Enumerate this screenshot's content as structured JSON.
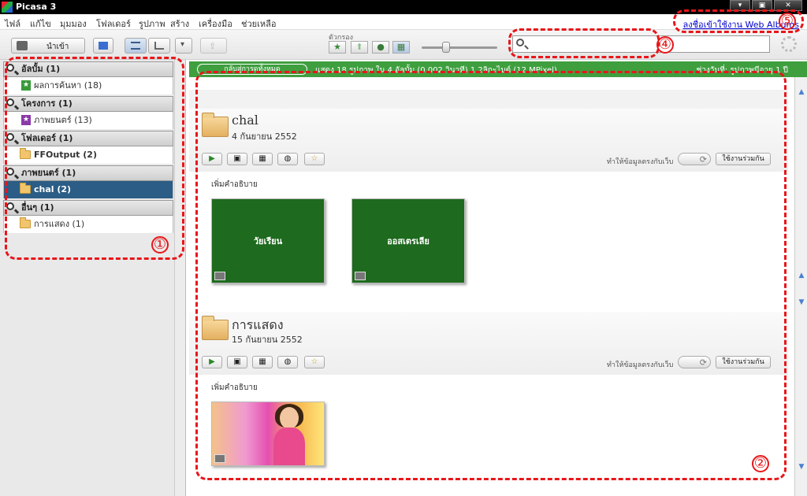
{
  "window": {
    "title": "Picasa 3"
  },
  "menu": [
    "ไฟล์",
    "แก้ไข",
    "มุมมอง",
    "โฟลเดอร์",
    "รูปภาพ",
    "สร้าง",
    "เครื่องมือ",
    "ช่วยเหลือ"
  ],
  "signin_link": "ลงชื่อเข้าใช้งาน Web Albums",
  "toolbar": {
    "import_label": "นำเข้า",
    "filter_label": "ตัวกรอง",
    "search_placeholder": ""
  },
  "sidebar": {
    "groups": [
      {
        "label": "อัลบั้ม (1)",
        "items": [
          {
            "label": "ผลการค้นหา (18)",
            "icon": "star-icon",
            "selected": false
          }
        ]
      },
      {
        "label": "โครงการ (1)",
        "items": [
          {
            "label": "ภาพยนตร์ (13)",
            "icon": "movie-icon",
            "selected": false
          }
        ]
      },
      {
        "label": "โฟลเดอร์ (1)",
        "items": [
          {
            "label": "FFOutput (2)",
            "icon": "folder-icon",
            "selected": false
          }
        ]
      },
      {
        "label": "ภาพยนตร์ (1)",
        "items": [
          {
            "label": "chal (2)",
            "icon": "folder-icon",
            "selected": true
          }
        ]
      },
      {
        "label": "อื่นๆ (1)",
        "items": [
          {
            "label": "การแสดง (1)",
            "icon": "folder-icon",
            "selected": false
          }
        ]
      }
    ]
  },
  "greenbar": {
    "back_label": "กลับสู่การดูทั้งหมด",
    "info": "แสดง 18 รูปภาพ ใน 4 อัลบั้ม (0.002 วินาที) 1.2ลิกะไบต์ (12 MPixel)",
    "range": "ช่วงวันที่: รูปภาพมีอายุ 1 ปี"
  },
  "albums": [
    {
      "title": "chal",
      "date": "4 กันยายน 2552",
      "sync_label": "ทำให้ข้อมูลตรงกับเว็บ",
      "share_label": "ใช้งานร่วมกัน",
      "add_caption": "เพิ่มคำอธิบาย",
      "items": [
        {
          "caption": "วัยเรียน"
        },
        {
          "caption": "ออสเตรเลีย"
        }
      ]
    },
    {
      "title": "การแสดง",
      "date": "15 กันยายน 2552",
      "sync_label": "ทำให้ข้อมูลตรงกับเว็บ",
      "share_label": "ใช้งานร่วมกัน",
      "add_caption": "เพิ่มคำอธิบาย",
      "items": [
        {
          "caption": ""
        }
      ]
    }
  ],
  "annotations": {
    "a1": "①",
    "a2": "②",
    "a4": "④",
    "a5": "⑤"
  },
  "colors": {
    "accent_green": "#3f9f3f",
    "selected_blue": "#2b5d86",
    "annotation_red": "#e8161a"
  }
}
